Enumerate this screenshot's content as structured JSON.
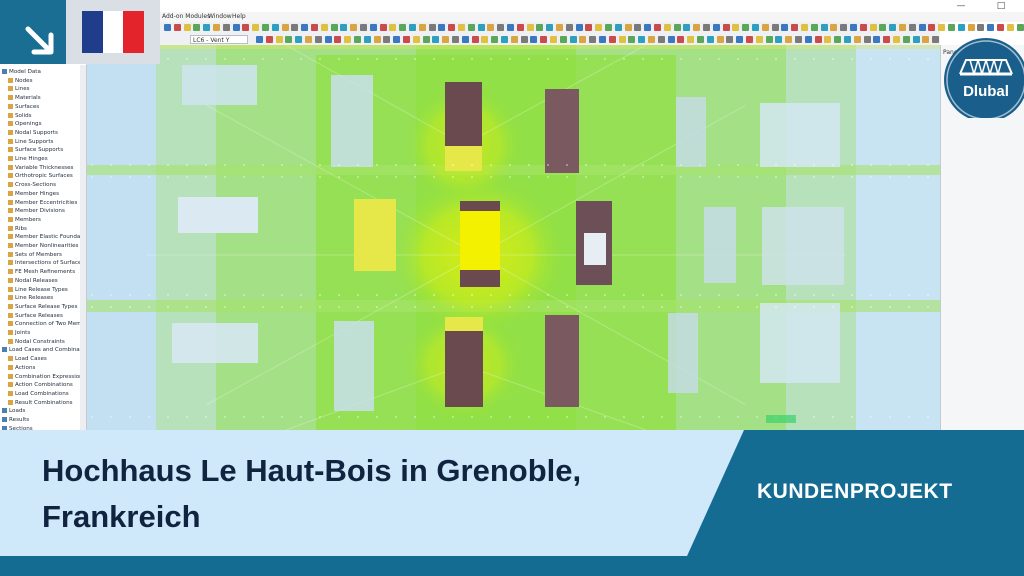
{
  "window": {
    "minimize_icon": "—",
    "maximize_icon": "□"
  },
  "menu": [
    "Add-on Modules",
    "Window",
    "Help"
  ],
  "toolbar": {
    "combo_loadcase": "LC6 - Vent Y"
  },
  "navigator": {
    "items": [
      {
        "label": "Model Data",
        "indent": 0
      },
      {
        "label": "Nodes",
        "indent": 1
      },
      {
        "label": "Lines",
        "indent": 1
      },
      {
        "label": "Materials",
        "indent": 1
      },
      {
        "label": "Surfaces",
        "indent": 1
      },
      {
        "label": "Solids",
        "indent": 1
      },
      {
        "label": "Openings",
        "indent": 1
      },
      {
        "label": "Nodal Supports",
        "indent": 1
      },
      {
        "label": "Line Supports",
        "indent": 1
      },
      {
        "label": "Surface Supports",
        "indent": 1
      },
      {
        "label": "Line Hinges",
        "indent": 1
      },
      {
        "label": "Variable Thicknesses",
        "indent": 1
      },
      {
        "label": "Orthotropic Surfaces",
        "indent": 1
      },
      {
        "label": "Cross-Sections",
        "indent": 1
      },
      {
        "label": "Member Hinges",
        "indent": 1
      },
      {
        "label": "Member Eccentricities",
        "indent": 1
      },
      {
        "label": "Member Divisions",
        "indent": 1
      },
      {
        "label": "Members",
        "indent": 1
      },
      {
        "label": "Ribs",
        "indent": 1
      },
      {
        "label": "Member Elastic Foundations",
        "indent": 1
      },
      {
        "label": "Member Nonlinearities",
        "indent": 1
      },
      {
        "label": "Sets of Members",
        "indent": 1
      },
      {
        "label": "Intersections of Surfaces",
        "indent": 1
      },
      {
        "label": "FE Mesh Refinements",
        "indent": 1
      },
      {
        "label": "Nodal Releases",
        "indent": 1
      },
      {
        "label": "Line Release Types",
        "indent": 1
      },
      {
        "label": "Line Releases",
        "indent": 1
      },
      {
        "label": "Surface Release Types",
        "indent": 1
      },
      {
        "label": "Surface Releases",
        "indent": 1
      },
      {
        "label": "Connection of Two Members",
        "indent": 1
      },
      {
        "label": "Joints",
        "indent": 1
      },
      {
        "label": "Nodal Constraints",
        "indent": 1
      },
      {
        "label": "Load Cases and Combinations",
        "indent": 0
      },
      {
        "label": "Load Cases",
        "indent": 1
      },
      {
        "label": "Actions",
        "indent": 1
      },
      {
        "label": "Combination Expressions",
        "indent": 1
      },
      {
        "label": "Action Combinations",
        "indent": 1
      },
      {
        "label": "Load Combinations",
        "indent": 1
      },
      {
        "label": "Result Combinations",
        "indent": 1
      },
      {
        "label": "Loads",
        "indent": 0
      },
      {
        "label": "Results",
        "indent": 0
      },
      {
        "label": "Sections",
        "indent": 0
      }
    ]
  },
  "panel": {
    "label": "Panel"
  },
  "logo": {
    "text": "Dlubal"
  },
  "banner": {
    "title": "Hochhaus Le Haut-Bois in Grenoble, Frankreich",
    "tag": "KUNDENPROJEKT"
  },
  "colors": {
    "brand_blue": "#156c93",
    "logo_blue": "#1a5f8c",
    "banner_light": "#cfe8fa",
    "result_green": "#8fe03c",
    "result_yellow": "#f3f000"
  }
}
